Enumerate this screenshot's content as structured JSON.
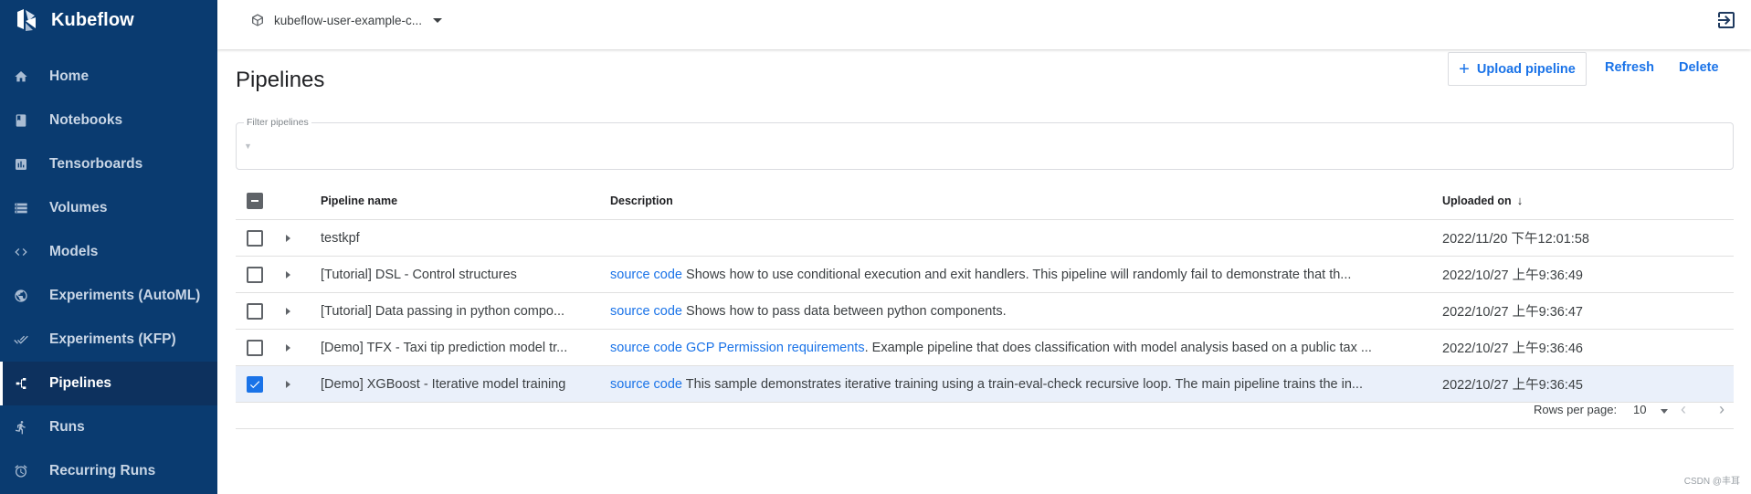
{
  "app": {
    "name": "Kubeflow"
  },
  "namespace": {
    "label": "kubeflow-user-example-c..."
  },
  "sidebar": {
    "items": [
      {
        "label": "Home",
        "icon": "home-icon",
        "active": false
      },
      {
        "label": "Notebooks",
        "icon": "notebook-icon",
        "active": false
      },
      {
        "label": "Tensorboards",
        "icon": "chart-icon",
        "active": false
      },
      {
        "label": "Volumes",
        "icon": "storage-icon",
        "active": false
      },
      {
        "label": "Models",
        "icon": "code-arrows-icon",
        "active": false
      },
      {
        "label": "Experiments (AutoML)",
        "icon": "tune-icon",
        "active": false
      },
      {
        "label": "Experiments (KFP)",
        "icon": "done-all-icon",
        "active": false
      },
      {
        "label": "Pipelines",
        "icon": "pipeline-icon",
        "active": true
      },
      {
        "label": "Runs",
        "icon": "run-icon",
        "active": false
      },
      {
        "label": "Recurring Runs",
        "icon": "alarm-icon",
        "active": false
      }
    ]
  },
  "page": {
    "title": "Pipelines",
    "upload_label": "Upload pipeline",
    "refresh_label": "Refresh",
    "delete_label": "Delete",
    "filter_label": "Filter pipelines"
  },
  "table": {
    "columns": {
      "name": "Pipeline name",
      "description": "Description",
      "uploaded": "Uploaded on"
    },
    "rows": [
      {
        "name": "testkpf",
        "links": [],
        "description": "",
        "uploaded": "2022/11/20 下午12:01:58",
        "checked": false
      },
      {
        "name": "[Tutorial] DSL - Control structures",
        "links": [
          "source code"
        ],
        "description": "Shows how to use conditional execution and exit handlers. This pipeline will randomly fail to demonstrate that th...",
        "uploaded": "2022/10/27 上午9:36:49",
        "checked": false
      },
      {
        "name": "[Tutorial] Data passing in python compo...",
        "links": [
          "source code"
        ],
        "description": "Shows how to pass data between python components.",
        "uploaded": "2022/10/27 上午9:36:47",
        "checked": false
      },
      {
        "name": "[Demo] TFX - Taxi tip prediction model tr...",
        "links": [
          "source code",
          "GCP Permission requirements"
        ],
        "description": ". Example pipeline that does classification with model analysis based on a public tax ...",
        "uploaded": "2022/10/27 上午9:36:46",
        "checked": false
      },
      {
        "name": "[Demo] XGBoost - Iterative model training",
        "links": [
          "source code"
        ],
        "description": "This sample demonstrates iterative training using a train-eval-check recursive loop. The main pipeline trains the in...",
        "uploaded": "2022/10/27 上午9:36:45",
        "checked": true
      }
    ]
  },
  "pager": {
    "rows_per_page_label": "Rows per page:",
    "rows_per_page_value": "10"
  },
  "watermark": "CSDN @丰耳",
  "colors": {
    "sidebar_bg": "#0a3b70",
    "accent": "#1a73e8"
  }
}
